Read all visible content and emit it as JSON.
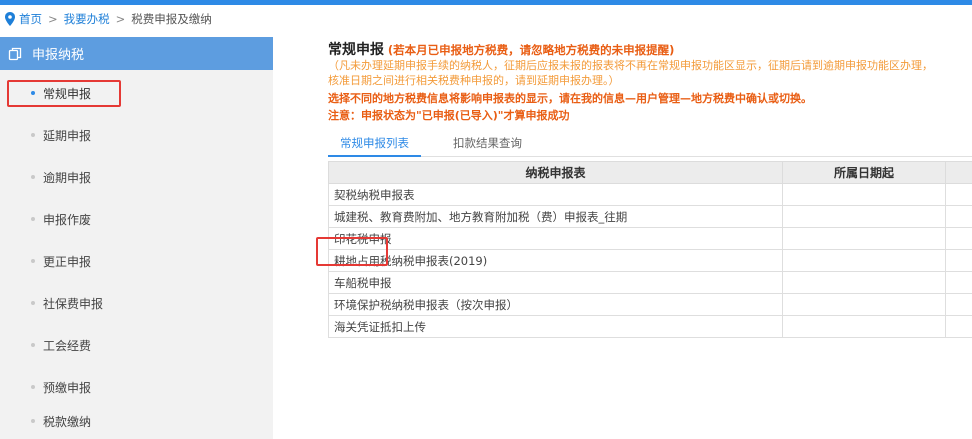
{
  "breadcrumb": {
    "home": "首页",
    "separator": ">",
    "level2": "我要办税",
    "current": "税费申报及缴纳",
    "icon": "location-pin-icon"
  },
  "sidebar": {
    "header": {
      "label": "申报纳税",
      "icon": "copy-icon"
    },
    "items": [
      {
        "label": "常规申报",
        "active": true
      },
      {
        "label": "延期申报"
      },
      {
        "label": "逾期申报"
      },
      {
        "label": "申报作废"
      },
      {
        "label": "更正申报"
      },
      {
        "label": "社保费申报"
      },
      {
        "label": "工会经费"
      },
      {
        "label": "预缴申报"
      },
      {
        "label": "税款缴纳"
      }
    ]
  },
  "main": {
    "title": "常规申报",
    "title_note": "(若本月已申报地方税费，请忽略地方税费的未申报提醒)",
    "notice_line1": "（凡未办理延期申报手续的纳税人，征期后应报未报的报表将不再在常规申报功能区显示，征期后请到逾期申报功能区办理，",
    "notice_line2": "核准日期之间进行相关税费种申报的，请到延期申报办理。）",
    "notice_line3": "选择不同的地方税费信息将影响申报表的显示，请在我的信息—用户管理—地方税费中确认或切换。",
    "notice_line4": "注意：申报状态为\"已申报(已导入)\"才算申报成功"
  },
  "tabs": {
    "items": [
      {
        "label": "常规申报列表",
        "active": true
      },
      {
        "label": "扣款结果查询"
      }
    ]
  },
  "table": {
    "headers": [
      "纳税申报表",
      "所属日期起",
      ""
    ],
    "rows": [
      {
        "name": "契税纳税申报表"
      },
      {
        "name": "城建税、教育费附加、地方教育附加税（费）申报表_往期"
      },
      {
        "name": "印花税申报"
      },
      {
        "name": "耕地占用税纳税申报表(2019)"
      },
      {
        "name": "车船税申报"
      },
      {
        "name": "环境保护税纳税申报表（按次申报）"
      },
      {
        "name": "海关凭证抵扣上传"
      }
    ]
  },
  "colors": {
    "accent": "#2e8ae6",
    "sidebar_header": "#5d9de0",
    "highlight_box": "#e53935",
    "notice_orange": "#f39b3a"
  }
}
